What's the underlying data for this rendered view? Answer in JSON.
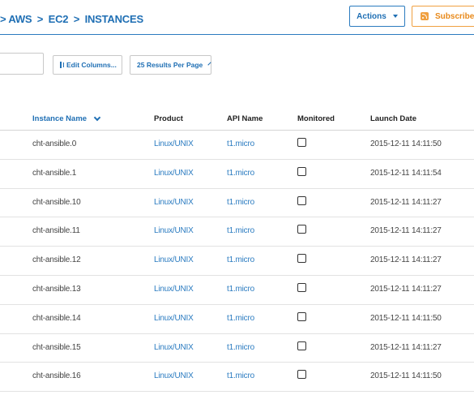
{
  "header": {
    "breadcrumb": [
      "AWS",
      "EC2",
      "INSTANCES"
    ],
    "breadcrumb_separator": ">",
    "actions_label": "Actions",
    "subscribe_label": "Subscribe"
  },
  "toolbar": {
    "search_value": "",
    "edit_columns_label": "Edit Columns...",
    "per_page_label": "25 Results Per Page"
  },
  "table": {
    "columns": [
      "Instance Name",
      "Product",
      "API Name",
      "Monitored",
      "Launch Date"
    ],
    "sorted_column": "Instance Name",
    "rows": [
      {
        "name": "cht-ansible.0",
        "product": "Linux/UNIX",
        "api": "t1.micro",
        "monitored": false,
        "date": "2015-12-11 14:11:50"
      },
      {
        "name": "cht-ansible.1",
        "product": "Linux/UNIX",
        "api": "t1.micro",
        "monitored": false,
        "date": "2015-12-11 14:11:54"
      },
      {
        "name": "cht-ansible.10",
        "product": "Linux/UNIX",
        "api": "t1.micro",
        "monitored": false,
        "date": "2015-12-11 14:11:27"
      },
      {
        "name": "cht-ansible.11",
        "product": "Linux/UNIX",
        "api": "t1.micro",
        "monitored": false,
        "date": "2015-12-11 14:11:27"
      },
      {
        "name": "cht-ansible.12",
        "product": "Linux/UNIX",
        "api": "t1.micro",
        "monitored": false,
        "date": "2015-12-11 14:11:27"
      },
      {
        "name": "cht-ansible.13",
        "product": "Linux/UNIX",
        "api": "t1.micro",
        "monitored": false,
        "date": "2015-12-11 14:11:27"
      },
      {
        "name": "cht-ansible.14",
        "product": "Linux/UNIX",
        "api": "t1.micro",
        "monitored": false,
        "date": "2015-12-11 14:11:50"
      },
      {
        "name": "cht-ansible.15",
        "product": "Linux/UNIX",
        "api": "t1.micro",
        "monitored": false,
        "date": "2015-12-11 14:11:27"
      },
      {
        "name": "cht-ansible.16",
        "product": "Linux/UNIX",
        "api": "t1.micro",
        "monitored": false,
        "date": "2015-12-11 14:11:50"
      }
    ]
  },
  "icons": {
    "actions": "chevron-down-icon",
    "subscribe": "rss-icon",
    "edit_columns": "columns-icon",
    "per_page": "chevron-down-icon",
    "sort": "sort-desc-icon"
  },
  "colors": {
    "accent": "#1f6fb4",
    "subscribe": "#e8891a",
    "link": "#2a7bc0"
  }
}
